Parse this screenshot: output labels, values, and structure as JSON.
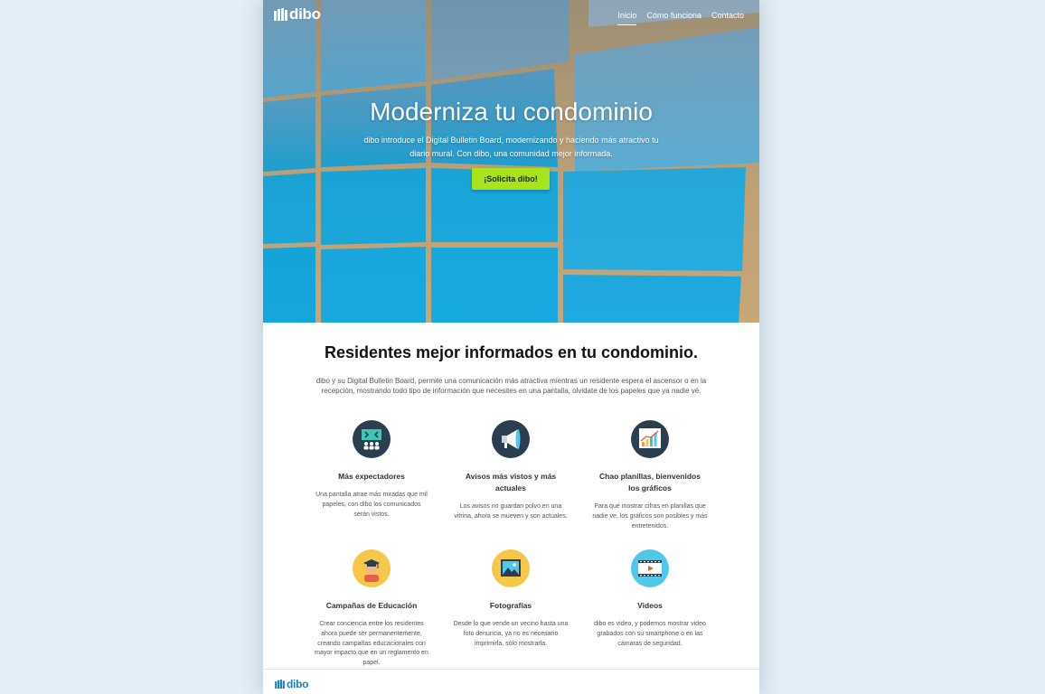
{
  "header": {
    "logo_text": "dibo",
    "nav": [
      {
        "label": "Inicio",
        "active": true
      },
      {
        "label": "Cómo funciona",
        "active": false
      },
      {
        "label": "Contacto",
        "active": false
      }
    ]
  },
  "hero": {
    "title": "Moderniza tu condominio",
    "subtitle": "dibo introduce el Digital Bulletin Board, modernizando y haciendo más atractivo tu diario mural. Con dibo, una comunidad mejor informada.",
    "cta_label": "¡Solicita dibo!"
  },
  "section": {
    "title": "Residentes mejor informados en tu condominio.",
    "description": "dibo y su Digital Bulletin Board, permite una comunicación más atractiva mientras un residente espera el ascensor o en la recepción, mostrando todo tipo de información que necesites en una pantalla, olvidate de los papeles que ya nadie vé."
  },
  "features": [
    {
      "icon": "audience-screen-icon",
      "title": "Más expectadores",
      "description": "Una pantalla atrae más miradas que mil papeles, con dibo los comunicados serán vistos."
    },
    {
      "icon": "megaphone-icon",
      "title": "Avisos más vistos y más actuales",
      "description": "Los avisos no guardan polvo en una vitrina, ahora se mueven y son actuales."
    },
    {
      "icon": "bar-chart-icon",
      "title": "Chao planillas, bienvenidos los gráficos",
      "description": "Para qué mostrar cifras en planillas que nadie ve, los gráficos son posibles y más entretenidos."
    },
    {
      "icon": "graduate-icon",
      "title": "Campañas de Educación",
      "description": "Crear conciencia entre los residentes ahora puede ser permanentemente, creando campañas educacionales con mayor impacto que en un reglamento en papel."
    },
    {
      "icon": "photo-icon",
      "title": "Fotografías",
      "description": "Desde lo que vende un vecino hasta una foto denuncia, ya no es necesario imprimirla, sólo mostrarla."
    },
    {
      "icon": "video-icon",
      "title": "Videos",
      "description": "dibo es video, y podemos mostrar video grabados con su smartphone o en las cámaras de seguridad."
    }
  ],
  "footer": {
    "logo_text": "dibo"
  },
  "colors": {
    "cta": "#a8e31b",
    "icon_dark": "#2b3e50",
    "icon_yellow": "#f7c74a",
    "icon_cyan": "#4fc9ea",
    "brand_blue": "#1c80c7",
    "page_bg": "#e3eef6"
  }
}
